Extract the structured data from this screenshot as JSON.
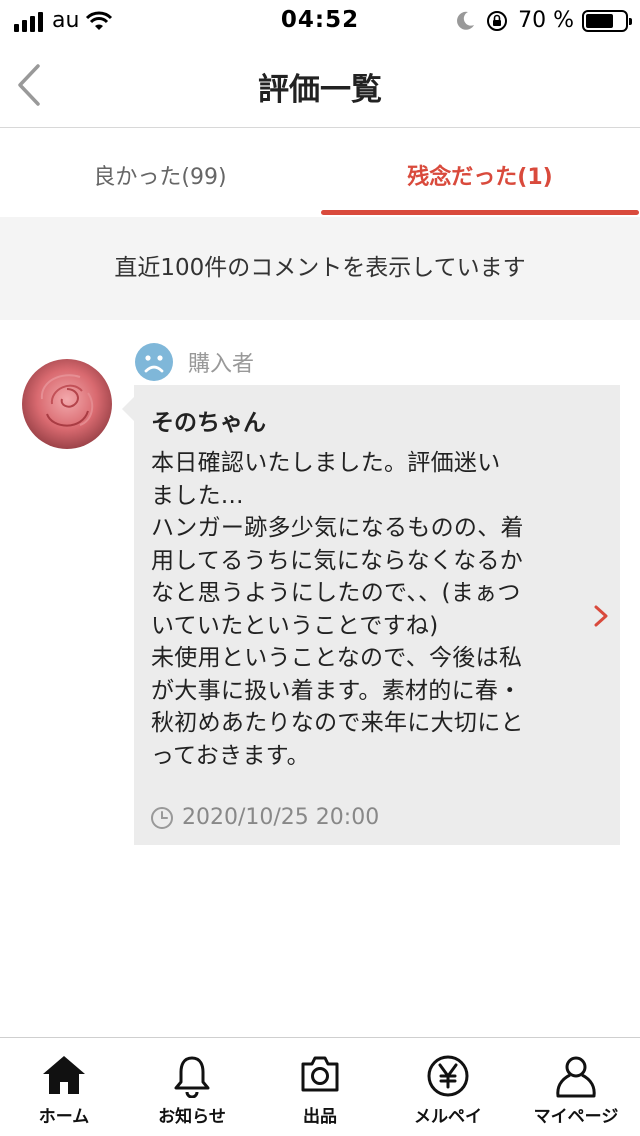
{
  "status_bar": {
    "carrier": "au",
    "time": "04:52",
    "battery_percent": "70 %",
    "battery_level": 0.7
  },
  "header": {
    "title": "評価一覧"
  },
  "tabs": [
    {
      "label": "良かった(99)",
      "active": false
    },
    {
      "label": "残念だった(1)",
      "active": true
    }
  ],
  "notice": "直近100件のコメントを表示しています",
  "review": {
    "role_label": "購入者",
    "name": "そのちゃん",
    "comment": "本日確認いたしました。評価迷い\nました...\nハンガー跡多少気になるものの、着\n用してるうちに気にならなくなるか\nなと思うようにしたので、、(まぁつ\nいていたということですね)\n未使用ということなので、今後は私\nが大事に扱い着ます。素材的に春・\n秋初めあたりなので来年に大切にと\nっておきます。",
    "timestamp": "2020/10/25 20:00",
    "rating_icon": "sad-face-icon"
  },
  "bottom_nav": [
    {
      "label": "ホーム",
      "icon": "home-icon"
    },
    {
      "label": "お知らせ",
      "icon": "bell-icon"
    },
    {
      "label": "出品",
      "icon": "camera-icon"
    },
    {
      "label": "メルペイ",
      "icon": "yen-icon"
    },
    {
      "label": "マイページ",
      "icon": "person-icon"
    }
  ],
  "colors": {
    "accent": "#d94a3c",
    "sad_face": "#7fb7d9",
    "bubble_bg": "#ececec",
    "notice_bg": "#f4f4f4"
  }
}
